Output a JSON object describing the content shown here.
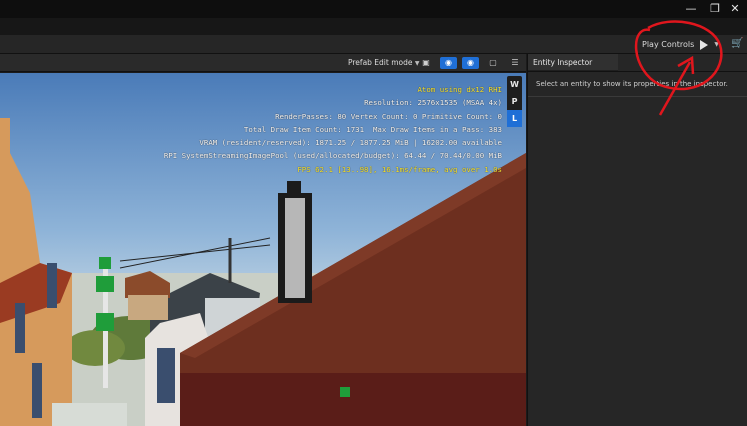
{
  "titlebar": {
    "minimize_icon": "minimize-icon",
    "restore_icon": "restore-icon",
    "close_icon": "close-icon"
  },
  "main_toolbar": {
    "play_controls_label": "Play Controls",
    "play_icon": "play-icon",
    "cart_icon": "cart-icon"
  },
  "viewport_toolbar": {
    "prefab_mode_label": "Prefab Edit mode",
    "camera_icon": "camera-icon",
    "gizmo_icon": "gizmo-icon",
    "display_icon": "display-icon",
    "layout_icon": "layout-icon",
    "menu_icon": "menu-icon"
  },
  "viewport": {
    "stats": [
      "Atom using dx12 RHI",
      "Resolution: 2576x1535 (MSAA 4x)",
      "RenderPasses: 80 Vertex Count: 0 Primitive Count: 0",
      "Total Draw Item Count: 1731  Max Draw Items in a Pass: 383",
      "VRAM (resident/reserved): 1871.25 / 1877.25 MiB | 16202.00 available",
      "RPI SystemStreamingImagePool (used/allocated/budget): 64.44 / 70.44/0.00 MiB",
      "FPS 62.1 [13..98], 16.1ms/frame, avg over 1.0s"
    ],
    "space_buttons": [
      "W",
      "P",
      "L"
    ]
  },
  "inspector": {
    "tab_label": "Entity Inspector",
    "message": "Select an entity to show its properties in the inspector."
  },
  "colors": {
    "accent": "#1f6fd6",
    "annotation": "#e0161d",
    "fps_text": "#f6e22e"
  }
}
